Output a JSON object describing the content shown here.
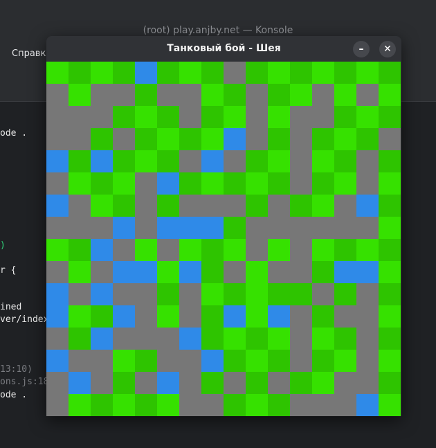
{
  "background_window": {
    "title": "(root) play.anjby.net — Konsole",
    "menu_item": "Справка",
    "terminal_lines": [
      "ode .",
      ")",
      "r {",
      "ined",
      "ver/index",
      "13:10)",
      "ons.js:18",
      "ode ."
    ]
  },
  "game_window": {
    "title": "Танковый бой - Шея",
    "minimize_icon": "minimize-icon",
    "close_icon": "close-icon",
    "minimize_glyph": "–",
    "close_glyph": "✕"
  },
  "colors": {
    "grass_light": "#36e100",
    "grass_dark": "#2ec400",
    "wall": "#777777",
    "water": "#2f8ae8"
  },
  "board": {
    "columns": 16,
    "rows": 16,
    "legend": {
      "G": "grass-light",
      "D": "grass-dark",
      "W": "wall",
      "B": "water"
    },
    "tiles": [
      "GDGDBDGDWDGDGDGD",
      "WGWWDWWGDWDGWGWG",
      "WWWDGDWDGWGWWDGD",
      "WWDWDGDGBWDWDGDW",
      "BDBDGDWBWDGWGDWD",
      "WGDGWBDGDGDWDGWG",
      "BWGDWDWWWDWDGWBD",
      "WWWBWBBBDWWWWWWG",
      "GDBWGWGDGWGWGDGD",
      "WGWBBGBDWGWWDBBG",
      "BWBWWDWGDGDDWDWD",
      "BGDBWGWDBGBWDWWG",
      "WDBWWWBDGDGWGDWD",
      "BWWGDWWBDGDWDGWG",
      "WBWDWBWDWDWDGWWD",
      "WGDGDGWWDGDWWWBG"
    ]
  }
}
